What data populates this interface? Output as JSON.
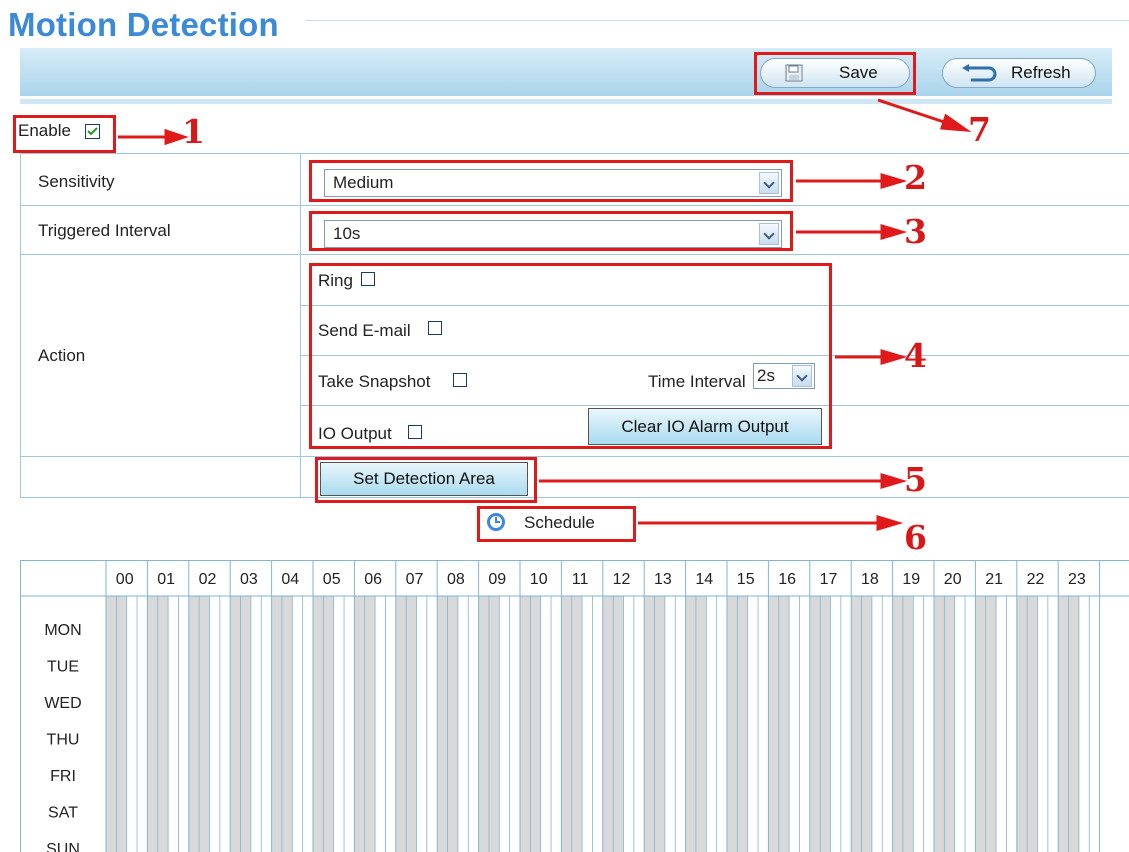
{
  "page": {
    "title": "Motion Detection"
  },
  "toolbar": {
    "save_label": "Save",
    "refresh_label": "Refresh"
  },
  "enable": {
    "label": "Enable",
    "checked": true
  },
  "sensitivity": {
    "label": "Sensitivity",
    "value": "Medium"
  },
  "triggered_interval": {
    "label": "Triggered Interval",
    "value": "10s"
  },
  "action": {
    "label": "Action",
    "ring_label": "Ring",
    "email_label": "Send E-mail",
    "snapshot_label": "Take Snapshot",
    "time_interval_label": "Time Interval",
    "time_interval_value": "2s",
    "io_output_label": "IO Output",
    "clear_io_label": "Clear IO Alarm Output"
  },
  "detection_area_label": "Set Detection Area",
  "schedule_label": "Schedule",
  "schedule": {
    "hours": [
      "00",
      "01",
      "02",
      "03",
      "04",
      "05",
      "06",
      "07",
      "08",
      "09",
      "10",
      "11",
      "12",
      "13",
      "14",
      "15",
      "16",
      "17",
      "18",
      "19",
      "20",
      "21",
      "22",
      "23"
    ],
    "days": [
      "MON",
      "TUE",
      "WED",
      "THU",
      "FRI",
      "SAT",
      "SUN"
    ]
  },
  "annotations": [
    "1",
    "2",
    "3",
    "4",
    "5",
    "6",
    "7"
  ],
  "colors": {
    "title": "#3b8ad8",
    "annotation": "#e01a1a",
    "grid_line": "#7fb6d6",
    "grid_shade": "#d9d9d9"
  }
}
